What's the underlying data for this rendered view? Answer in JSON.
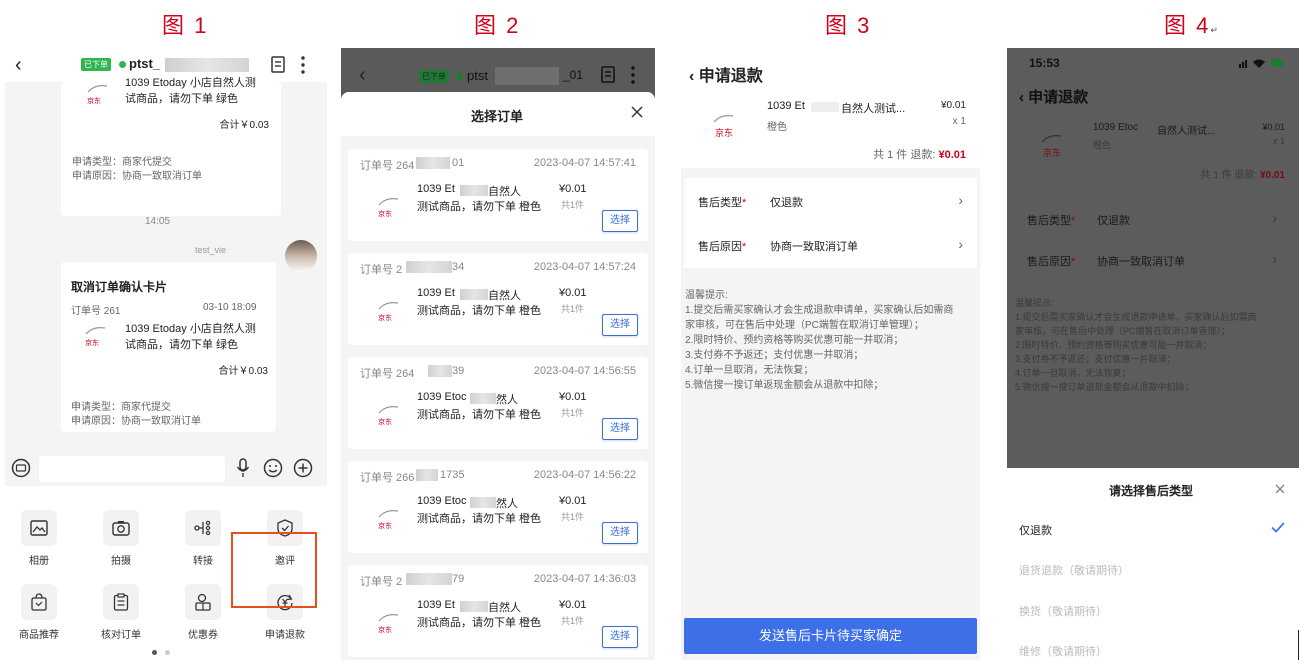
{
  "figure_labels": [
    "图 1",
    "图 2",
    "图 3",
    "图 4"
  ],
  "figure4_mark": "↵",
  "colors": {
    "accent_red": "#d0021b",
    "primary_blue": "#3d6fe8",
    "status_green": "#2fb552",
    "highlight_orange": "#e8501b"
  },
  "p1": {
    "status_badge": "已下单",
    "name": "ptst_",
    "card1": {
      "product_line1": "1039 Etoday 小店自然人测",
      "product_line2": "试商品，请勿下单 绿色",
      "logo": "京东",
      "total": "合计￥0.03",
      "type_label": "申请类型：商家代提交",
      "reason_label": "申请原因：协商一致取消订单"
    },
    "timestamp": "14:05",
    "sender": "test_vie",
    "card2": {
      "title": "取消订单确认卡片",
      "order_no": "订单号 261",
      "order_time": "03-10 18:09",
      "product_line1": "1039 Etoday 小店自然人测",
      "product_line2": "试商品，请勿下单 绿色",
      "logo": "京东",
      "total": "合计￥0.03",
      "type_label": "申请类型：商家代提交",
      "reason_label": "申请原因：协商一致取消订单"
    },
    "tools": [
      "相册",
      "拍摄",
      "转接",
      "邀评",
      "商品推荐",
      "核对订单",
      "优惠券",
      "申请退款"
    ]
  },
  "p2": {
    "top_name": "ptst",
    "top_suffix": "_01",
    "status_badge": "已下单",
    "title": "选择订单",
    "select_label": "选择",
    "orders": [
      {
        "order_no": "订单号 264",
        "suffix": "01",
        "time": "2023-04-07 14:57:41",
        "line1": "1039 Et",
        "line1_end": "自然人",
        "line2": "测试商品，请勿下单 橙色",
        "price": "¥0.01",
        "count": "共1件"
      },
      {
        "order_no": "订单号 2",
        "suffix": "34",
        "time": "2023-04-07 14:57:24",
        "line1": "1039 Et",
        "line1_end": "自然人",
        "line2": "测试商品，请勿下单 橙色",
        "price": "¥0.01",
        "count": "共1件"
      },
      {
        "order_no": "订单号 264",
        "suffix": "39",
        "time": "2023-04-07 14:56:55",
        "line1": "1039 Etoc",
        "line1_end": "然人",
        "line2": "测试商品，请勿下单 橙色",
        "price": "¥0.01",
        "count": "共1件"
      },
      {
        "order_no": "订单号 266",
        "suffix": "1735",
        "time": "2023-04-07 14:56:22",
        "line1": "1039 Etoc",
        "line1_end": "然人",
        "line2": "测试商品，请勿下单 橙色",
        "price": "¥0.01",
        "count": "共1件"
      },
      {
        "order_no": "订单号 2",
        "suffix": "79",
        "time": "2023-04-07 14:36:03",
        "line1": "1039 Et",
        "line1_end": "自然人",
        "line2": "测试商品，请勿下单 橙色",
        "price": "¥0.01",
        "count": "共1件"
      }
    ],
    "logo": "京东"
  },
  "p3": {
    "title": "申请退款",
    "product_name": "1039 Et",
    "product_name_end": "自然人测试...",
    "variant": "橙色",
    "price": "¥0.01",
    "qty": "x 1",
    "summary": "共 1 件  退款: ",
    "refund": "¥0.01",
    "logo": "京东",
    "type_label": "售后类型",
    "type_value": "仅退款",
    "reason_label": "售后原因",
    "reason_value": "协商一致取消订单",
    "tips_title": "温馨提示:",
    "tips": [
      "1.提交后需买家确认才会生成退款申请单，买家确认后如需商",
      "家审核，可在售后中处理（PC端暂在取消订单管理）；",
      "2.限时特价、预约资格等购买优惠可能一并取消；",
      "3.支付券不予返还；支付优惠一并取消；",
      "4.订单一旦取消，无法恢复；",
      "5.微信搜一搜订单返现金额会从退款中扣除；"
    ],
    "submit": "发送售后卡片待买家确定"
  },
  "p4": {
    "time": "15:53",
    "title": "申请退款",
    "product_name": "1039 Etoc",
    "product_name_end": "自然人测试...",
    "variant": "橙色",
    "price": "¥0.01",
    "qty": "x 1",
    "summary": "共 1 件  退款: ",
    "refund": "¥0.01",
    "logo": "京东",
    "type_label": "售后类型",
    "type_value": "仅退款",
    "reason_label": "售后原因",
    "reason_value": "协商一致取消订单",
    "tips_title": "温馨提示:",
    "tips": [
      "1.提交后需买家确认才会生成退款申请单，买家确认后如需商",
      "家审核，可在售后中处理（PC端暂在取消订单管理）；",
      "2.限时特价、预约资格等购买优惠可能一并取消；",
      "3.支付券不予返还；支付优惠一并取消；",
      "4.订单一旦取消，无法恢复；",
      "5.微信搜一搜订单返现金额会从退款中扣除；"
    ],
    "sheet_title": "请选择售后类型",
    "options": [
      "仅退款",
      "退货退款（敬请期待）",
      "换货（敬请期待）",
      "维修（敬请期待）"
    ]
  }
}
